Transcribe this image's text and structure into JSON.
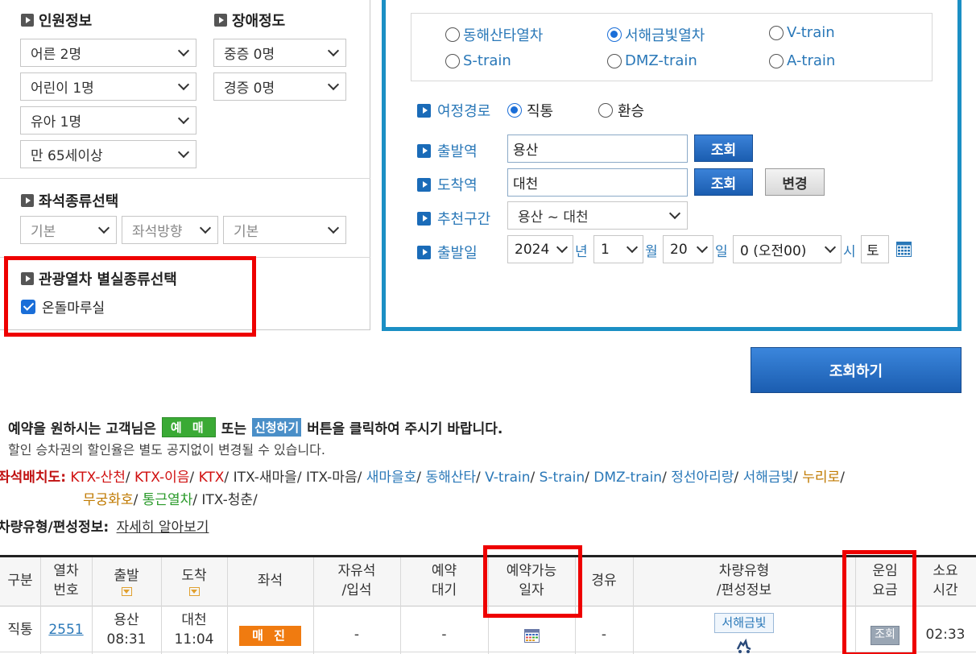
{
  "left": {
    "passenger_title": "인원정보",
    "disability_title": "장애정도",
    "passengers": [
      "어른 2명",
      "어린이 1명",
      "유아 1명",
      "만 65세이상"
    ],
    "disability": [
      "중증 0명",
      "경증 0명"
    ],
    "seat_type_title": "좌석종류선택",
    "seat_selects": [
      "기본",
      "좌석방향",
      "기본"
    ],
    "tour_title": "관광열차 별실종류선택",
    "tour_option": "온돌마루실"
  },
  "trains": {
    "options": [
      {
        "label": "동해산타열차",
        "selected": false
      },
      {
        "label": "서해금빛열차",
        "selected": true
      },
      {
        "label": "V-train",
        "selected": false
      },
      {
        "label": "S-train",
        "selected": false
      },
      {
        "label": "DMZ-train",
        "selected": false
      },
      {
        "label": "A-train",
        "selected": false
      }
    ]
  },
  "route": {
    "label": "여정경로",
    "direct": "직통",
    "transfer": "환승"
  },
  "departure": {
    "label": "출발역",
    "value": "용산",
    "btn": "조회"
  },
  "arrival": {
    "label": "도착역",
    "value": "대천",
    "btn": "조회",
    "change": "변경"
  },
  "recommend": {
    "label": "추천구간",
    "value": "용산 ~ 대천"
  },
  "date": {
    "label": "출발일",
    "year": "2024",
    "year_unit": "년",
    "month": "1",
    "month_unit": "월",
    "day": "20",
    "day_unit": "일",
    "hour": "0 (오전00)",
    "hour_unit": "시",
    "weekday": "토"
  },
  "search_button": "조회하기",
  "notice": {
    "line1_a": "예약을 원하시는 고객님은",
    "yemae": "예 매",
    "or": "또는",
    "apply": "신청하기",
    "line1_b": "버튼을 클릭하여 주시기 바랍니다.",
    "line2": "할인 승차권의 할인율은 별도 공지없이 변경될 수 있습니다."
  },
  "seat_layout": {
    "label": "좌석배치도:",
    "links": [
      {
        "text": "KTX-산천",
        "color": "red"
      },
      {
        "text": "KTX-이음",
        "color": "red"
      },
      {
        "text": "KTX",
        "color": "red"
      },
      {
        "text": "ITX-새마을",
        "color": "gray"
      },
      {
        "text": "ITX-마음",
        "color": "gray"
      },
      {
        "text": "새마을호",
        "color": "blue"
      },
      {
        "text": "동해산타",
        "color": "blue"
      },
      {
        "text": "V-train",
        "color": "blue"
      },
      {
        "text": "S-train",
        "color": "blue"
      },
      {
        "text": "DMZ-train",
        "color": "blue"
      },
      {
        "text": "정선아리랑",
        "color": "blue"
      },
      {
        "text": "서해금빛",
        "color": "blue"
      },
      {
        "text": "누리로",
        "color": "orange"
      }
    ],
    "links2": [
      {
        "text": "무궁화호",
        "color": "orange"
      },
      {
        "text": "통근열차",
        "color": "green"
      },
      {
        "text": "ITX-청춘",
        "color": "gray"
      }
    ]
  },
  "vehicle_info": {
    "label": "차량유형/편성정보:",
    "link": "자세히 알아보기"
  },
  "table": {
    "headers": {
      "type": "구분",
      "train_no": [
        "열차",
        "번호"
      ],
      "dep": "출발",
      "arr": "도착",
      "seat": "좌석",
      "free": [
        "자유석",
        "/입석"
      ],
      "wait": [
        "예약",
        "대기"
      ],
      "avail": [
        "예약가능",
        "일자"
      ],
      "via": "경유",
      "vehicle": [
        "차량유형",
        "/편성정보"
      ],
      "fare": [
        "운임",
        "요금"
      ],
      "duration": [
        "소요",
        "시간"
      ]
    },
    "row": {
      "type": "직통",
      "train_no": "2551",
      "dep_station": "용산",
      "dep_time": "08:31",
      "arr_station": "대천",
      "arr_time": "11:04",
      "seat_badge": "매 진",
      "free": "-",
      "wait": "-",
      "via": "-",
      "vehicle_badge": "서해금빛",
      "fare_btn": "조회",
      "duration": "02:33"
    }
  }
}
